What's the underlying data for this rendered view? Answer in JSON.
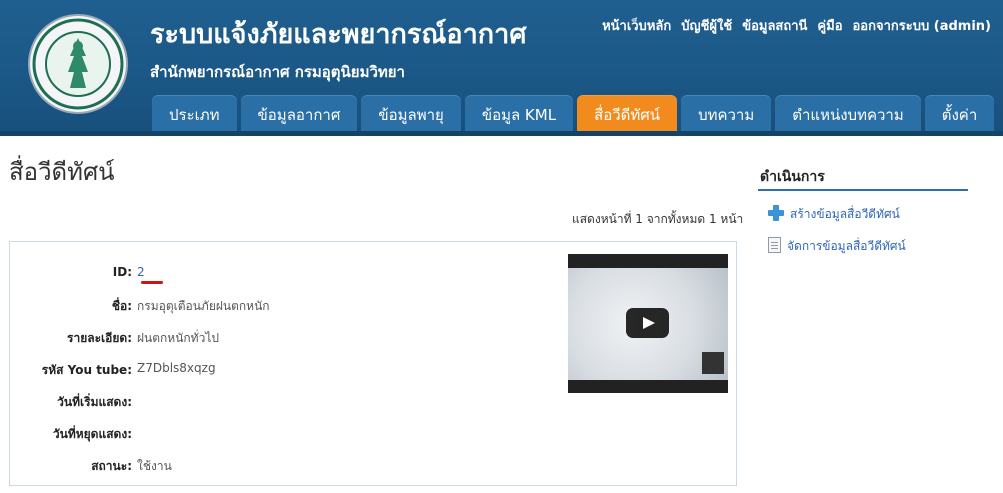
{
  "header": {
    "title": "ระบบแจ้งภัยและพยากรณ์อากาศ",
    "subtitle": "สำนักพยากรณ์อากาศ กรมอุตุนิยมวิทยา",
    "logo_text": "กรมอุตุนิยมวิทยา METEOROLOGICAL DEPARTMENT"
  },
  "toplinks": [
    "หน้าเว็บหลัก",
    "บัญชีผู้ใช้",
    "ข้อมูลสถานี",
    "คู่มือ",
    "ออกจากระบบ (admin)"
  ],
  "tabs": [
    {
      "label": "ประเภท"
    },
    {
      "label": "ข้อมูลอากาศ"
    },
    {
      "label": "ข้อมูลพายุ"
    },
    {
      "label": "ข้อมูล KML"
    },
    {
      "label": "สื่อวีดีทัศน์"
    },
    {
      "label": "บทความ"
    },
    {
      "label": "ตำแหน่งบทความ"
    },
    {
      "label": "ตั้งค่า"
    }
  ],
  "active_tab": "สื่อวีดีทัศน์",
  "main": {
    "page_title": "สื่อวีดีทัศน์",
    "pager": "แสดงหน้าที่ 1 จากทั้งหมด 1 หน้า",
    "record": {
      "id_label": "ID:",
      "id_value": "2",
      "name_label": "ชื่อ:",
      "name_value": "กรมอุตุเตือนภัยฝนตกหนัก",
      "detail_label": "รายละเอียด:",
      "detail_value": "ฝนตกหนักทั่วไป",
      "youtube_label": "รหัส You tube:",
      "youtube_value": "Z7Dbls8xqzg",
      "start_label": "วันที่เริ่มแสดง:",
      "start_value": "",
      "stop_label": "วันที่หยุดแสดง:",
      "stop_value": "",
      "status_label": "สถานะ:",
      "status_value": "ใช้งาน"
    }
  },
  "sidebar": {
    "title": "ดำเนินการ",
    "items": [
      {
        "label": "สร้างข้อมูลสื่อวีดีทัศน์",
        "icon": "plus-icon"
      },
      {
        "label": "จัดการข้อมูลสื่อวีดีทัศน์",
        "icon": "document-icon"
      }
    ]
  },
  "colors": {
    "header": "#1b5786",
    "active_tab": "#f28b1e",
    "tab": "#2a6fa5",
    "link": "#2f66b3"
  }
}
